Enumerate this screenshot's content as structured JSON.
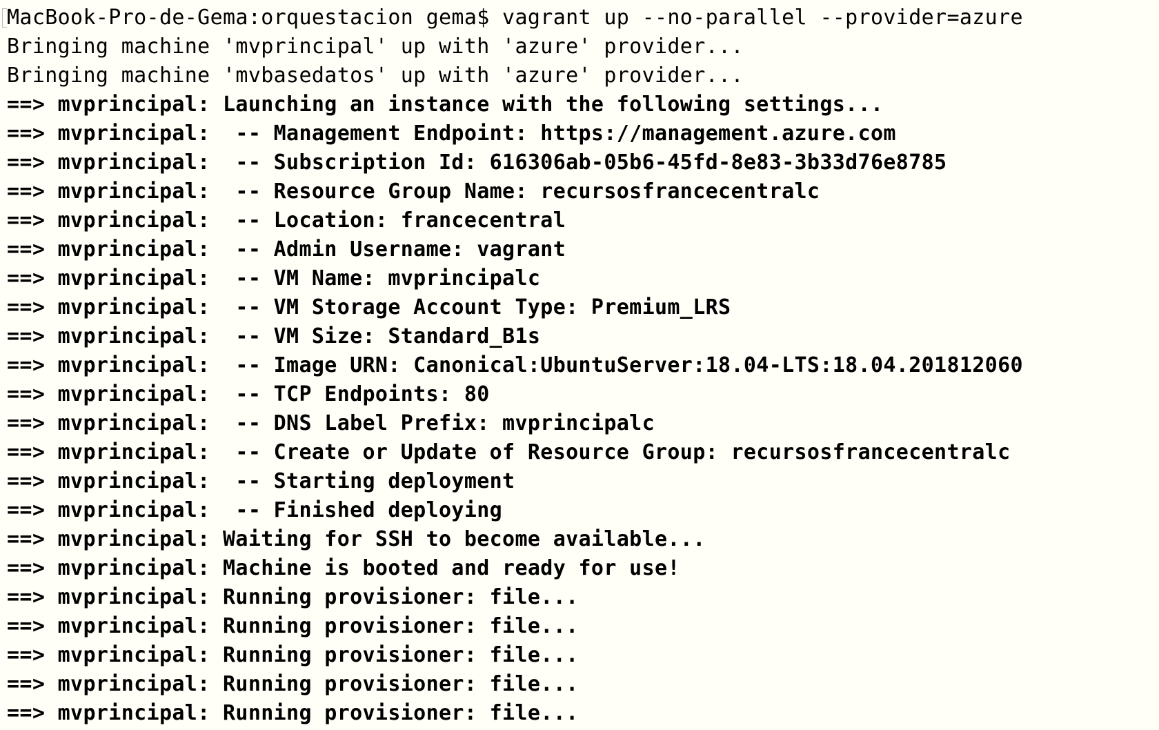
{
  "terminal": {
    "prompt": "MacBook-Pro-de-Gema:orquestacion gema$ vagrant up --no-parallel --provider=azure",
    "plain_lines": [
      "Bringing machine 'mvprincipal' up with 'azure' provider...",
      "Bringing machine 'mvbasedatos' up with 'azure' provider..."
    ],
    "output_lines": [
      "==> mvprincipal: Launching an instance with the following settings...",
      "==> mvprincipal:  -- Management Endpoint: https://management.azure.com",
      "==> mvprincipal:  -- Subscription Id: 616306ab-05b6-45fd-8e83-3b33d76e8785",
      "==> mvprincipal:  -- Resource Group Name: recursosfrancecentralc",
      "==> mvprincipal:  -- Location: francecentral",
      "==> mvprincipal:  -- Admin Username: vagrant",
      "==> mvprincipal:  -- VM Name: mvprincipalc",
      "==> mvprincipal:  -- VM Storage Account Type: Premium_LRS",
      "==> mvprincipal:  -- VM Size: Standard_B1s",
      "==> mvprincipal:  -- Image URN: Canonical:UbuntuServer:18.04-LTS:18.04.201812060",
      "==> mvprincipal:  -- TCP Endpoints: 80",
      "==> mvprincipal:  -- DNS Label Prefix: mvprincipalc",
      "==> mvprincipal:  -- Create or Update of Resource Group: recursosfrancecentralc",
      "==> mvprincipal:  -- Starting deployment",
      "==> mvprincipal:  -- Finished deploying",
      "==> mvprincipal: Waiting for SSH to become available...",
      "==> mvprincipal: Machine is booted and ready for use!",
      "==> mvprincipal: Running provisioner: file...",
      "==> mvprincipal: Running provisioner: file...",
      "==> mvprincipal: Running provisioner: file...",
      "==> mvprincipal: Running provisioner: file...",
      "==> mvprincipal: Running provisioner: file..."
    ]
  },
  "colors": {
    "background": "#fffef7",
    "text": "#000000"
  }
}
